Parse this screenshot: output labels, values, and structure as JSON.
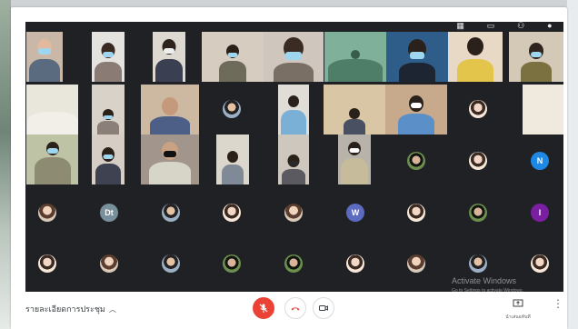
{
  "meeting": {
    "details_label": "รายละเอียดการประชุม",
    "present_label": "นำเสนอทันที",
    "watermark_title": "Activate Windows",
    "watermark_subtitle": "Go to Settings to activate Windows."
  },
  "top_icons": [
    "grid-view-icon",
    "chat-icon",
    "people-icon",
    "account-icon"
  ],
  "participant_initials": {
    "n": "N",
    "dt": "Dt",
    "w": "W",
    "i": "I"
  },
  "colors": {
    "stage_bg": "#202124",
    "mic_off_red": "#ea4335",
    "initial_n": "#1e88e5",
    "initial_dt": "#78909c",
    "initial_w": "#5c6bc0",
    "initial_i": "#7b1fa2"
  }
}
